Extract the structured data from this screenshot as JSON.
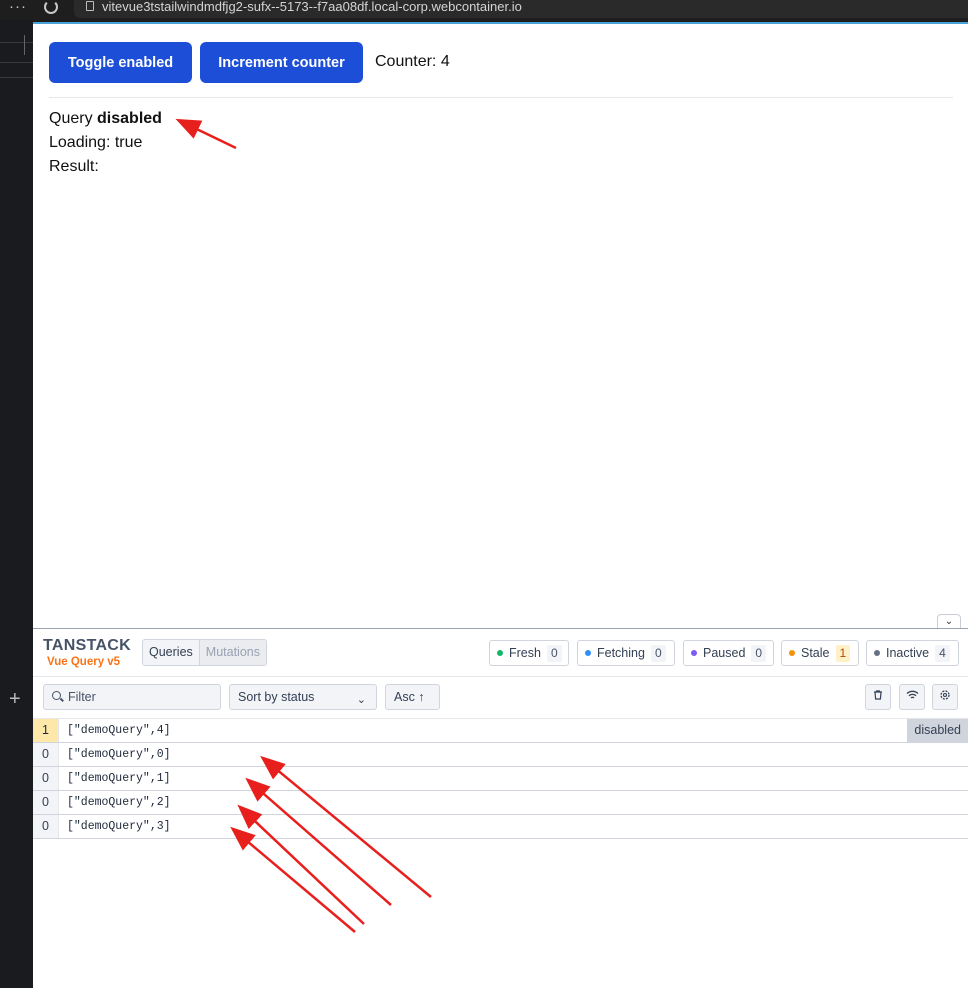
{
  "browser": {
    "url": "vitevue3tstailwindmdfjg2-sufx--5173--f7aa08df.local-corp.webcontainer.io",
    "menu_glyph": "···"
  },
  "app": {
    "toggle_label": "Toggle enabled",
    "increment_label": "Increment counter",
    "counter_text": "Counter: 4",
    "query_prefix": "Query",
    "query_state": "disabled",
    "loading_text": "Loading: true",
    "result_text": "Result:"
  },
  "devtools": {
    "logo_main": "TANSTACK",
    "logo_sub": "Vue Query v5",
    "tabs": [
      "Queries",
      "Mutations"
    ],
    "badges": [
      {
        "label": "Fresh",
        "count": "0",
        "color": "#12b76a"
      },
      {
        "label": "Fetching",
        "count": "0",
        "color": "#2e90fa"
      },
      {
        "label": "Paused",
        "count": "0",
        "color": "#7a5af8"
      },
      {
        "label": "Stale",
        "count": "1",
        "color": "#f79009"
      },
      {
        "label": "Inactive",
        "count": "4",
        "color": "#667085"
      }
    ],
    "filter_placeholder": "Filter",
    "sort_label": "Sort by status",
    "asc_label": "Asc ↑",
    "queries": [
      {
        "observers": "1",
        "key": "[\"demoQuery\",4]",
        "state": "disabled"
      },
      {
        "observers": "0",
        "key": "[\"demoQuery\",0]",
        "state": ""
      },
      {
        "observers": "0",
        "key": "[\"demoQuery\",1]",
        "state": ""
      },
      {
        "observers": "0",
        "key": "[\"demoQuery\",2]",
        "state": ""
      },
      {
        "observers": "0",
        "key": "[\"demoQuery\",3]",
        "state": ""
      }
    ]
  },
  "colors": {
    "button": "#1d4ed8",
    "annotation_arrow": "#e8201d",
    "brand_orange": "#f97316"
  }
}
